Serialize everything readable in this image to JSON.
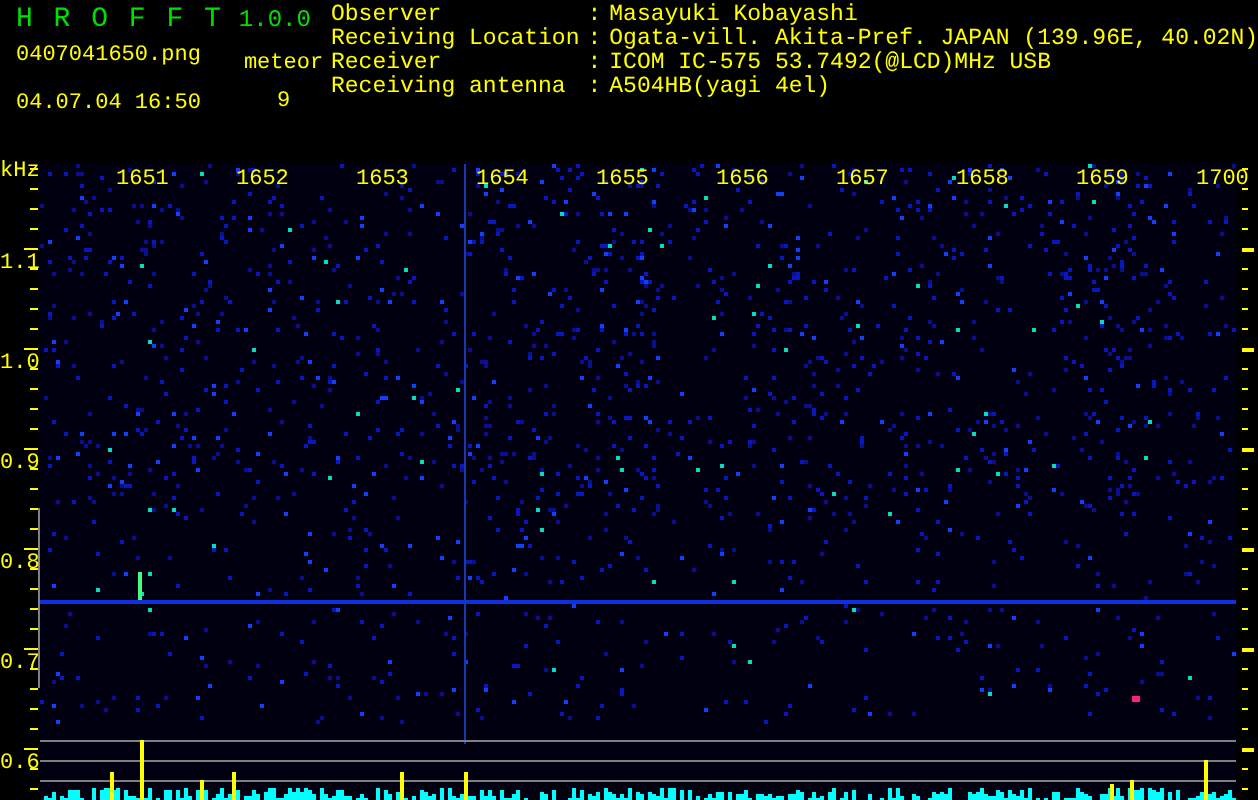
{
  "app": {
    "title": "H R O F F T",
    "version": "1.0.0"
  },
  "file": {
    "name": "0407041650.png",
    "datetime": "04.07.04 16:50"
  },
  "meteor": {
    "label": "meteor",
    "count": "9"
  },
  "station": [
    {
      "label": "Observer",
      "separator": ":",
      "value": "Masayuki Kobayashi"
    },
    {
      "label": "Receiving Location",
      "separator": ":",
      "value": "Ogata-vill. Akita-Pref. JAPAN (139.96E, 40.02N)"
    },
    {
      "label": "Receiver",
      "separator": ":",
      "value": "ICOM IC-575 53.7492(@LCD)MHz USB"
    },
    {
      "label": "Receiving antenna",
      "separator": ":",
      "value": "A504HB(yagi 4el)"
    }
  ],
  "spectrogram": {
    "unit": "kHz",
    "frequency_labels": [
      "1651",
      "1652",
      "1653",
      "1654",
      "1655",
      "1656",
      "1657",
      "1658",
      "1659",
      "1700"
    ],
    "level_labels": [
      "1.1",
      "1.0",
      "0.9",
      "0.8",
      "0.7",
      "0.6"
    ]
  }
}
